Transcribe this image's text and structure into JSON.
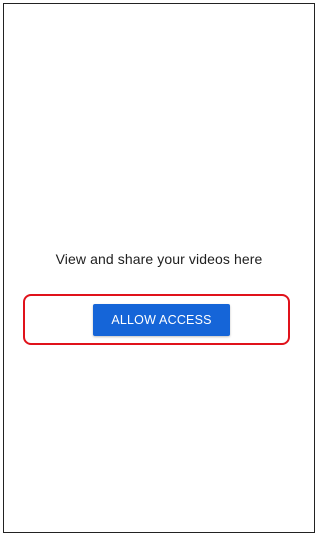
{
  "main": {
    "message": "View and share your videos here",
    "allow_button_label": "ALLOW ACCESS"
  },
  "colors": {
    "button_background": "#1565d8",
    "highlight_border": "#e0121b"
  }
}
